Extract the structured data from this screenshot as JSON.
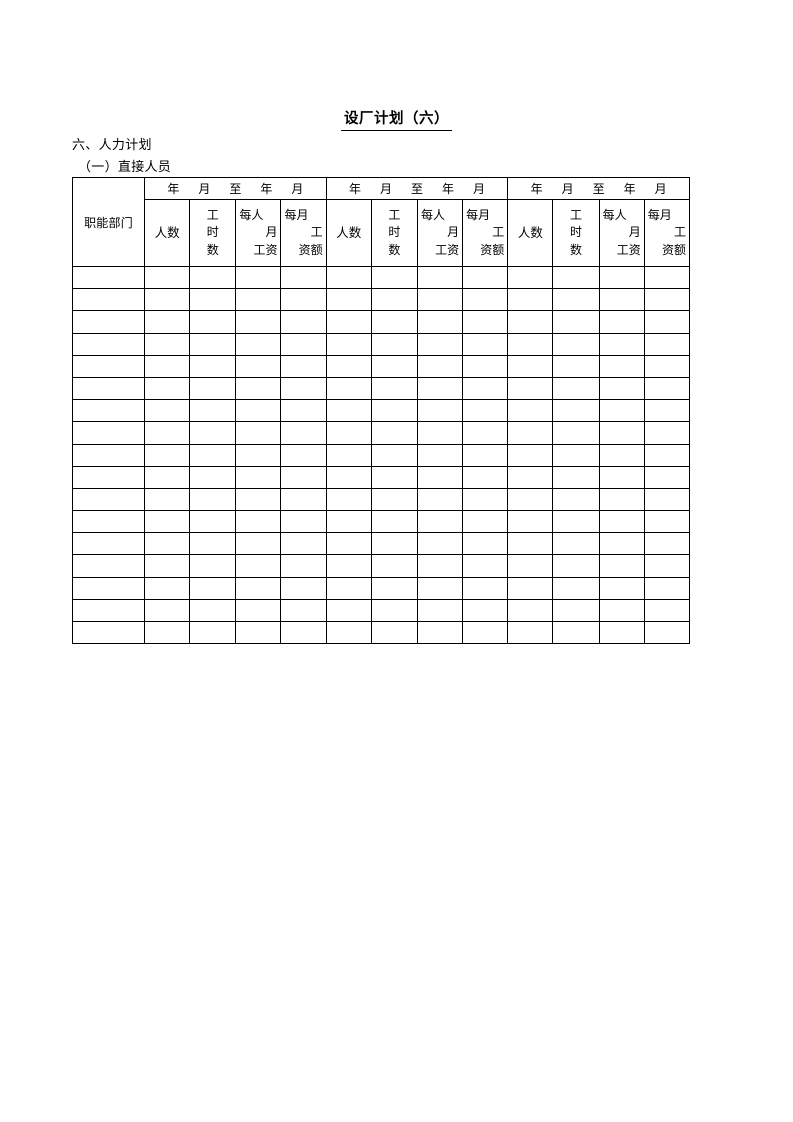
{
  "document": {
    "title": "设厂计划（六）",
    "section_heading": "六、人力计划",
    "subsection_heading": "（一）直接人员"
  },
  "table": {
    "row_label_header": "职能部门",
    "period_label": "年　月　至　年　月",
    "periods": [
      {
        "index": 1,
        "label": "年　月　至　年　月"
      },
      {
        "index": 2,
        "label": "年　月　至　年　月"
      },
      {
        "index": 3,
        "label": "年　月　至　年　月"
      }
    ],
    "column_headers": [
      {
        "key": "headcount",
        "label": "人数",
        "lines": [
          "人数"
        ]
      },
      {
        "key": "work_hours",
        "label": "工时数",
        "lines": [
          "工",
          "时",
          "数"
        ]
      },
      {
        "key": "wage_per_person_month",
        "label": "每人月工资",
        "lines": [
          "每人",
          "月",
          "工资"
        ]
      },
      {
        "key": "wage_total_month",
        "label": "每月工资额",
        "lines": [
          "每月",
          "工",
          "资额"
        ]
      }
    ],
    "data_rows": [
      {
        "dept": "",
        "cells": [
          "",
          "",
          "",
          "",
          "",
          "",
          "",
          "",
          "",
          "",
          "",
          ""
        ]
      },
      {
        "dept": "",
        "cells": [
          "",
          "",
          "",
          "",
          "",
          "",
          "",
          "",
          "",
          "",
          "",
          ""
        ]
      },
      {
        "dept": "",
        "cells": [
          "",
          "",
          "",
          "",
          "",
          "",
          "",
          "",
          "",
          "",
          "",
          ""
        ]
      },
      {
        "dept": "",
        "cells": [
          "",
          "",
          "",
          "",
          "",
          "",
          "",
          "",
          "",
          "",
          "",
          ""
        ]
      },
      {
        "dept": "",
        "cells": [
          "",
          "",
          "",
          "",
          "",
          "",
          "",
          "",
          "",
          "",
          "",
          ""
        ]
      },
      {
        "dept": "",
        "cells": [
          "",
          "",
          "",
          "",
          "",
          "",
          "",
          "",
          "",
          "",
          "",
          ""
        ]
      },
      {
        "dept": "",
        "cells": [
          "",
          "",
          "",
          "",
          "",
          "",
          "",
          "",
          "",
          "",
          "",
          ""
        ]
      },
      {
        "dept": "",
        "cells": [
          "",
          "",
          "",
          "",
          "",
          "",
          "",
          "",
          "",
          "",
          "",
          ""
        ]
      },
      {
        "dept": "",
        "cells": [
          "",
          "",
          "",
          "",
          "",
          "",
          "",
          "",
          "",
          "",
          "",
          ""
        ]
      },
      {
        "dept": "",
        "cells": [
          "",
          "",
          "",
          "",
          "",
          "",
          "",
          "",
          "",
          "",
          "",
          ""
        ]
      },
      {
        "dept": "",
        "cells": [
          "",
          "",
          "",
          "",
          "",
          "",
          "",
          "",
          "",
          "",
          "",
          ""
        ]
      },
      {
        "dept": "",
        "cells": [
          "",
          "",
          "",
          "",
          "",
          "",
          "",
          "",
          "",
          "",
          "",
          ""
        ]
      },
      {
        "dept": "",
        "cells": [
          "",
          "",
          "",
          "",
          "",
          "",
          "",
          "",
          "",
          "",
          "",
          ""
        ]
      },
      {
        "dept": "",
        "cells": [
          "",
          "",
          "",
          "",
          "",
          "",
          "",
          "",
          "",
          "",
          "",
          ""
        ]
      },
      {
        "dept": "",
        "cells": [
          "",
          "",
          "",
          "",
          "",
          "",
          "",
          "",
          "",
          "",
          "",
          ""
        ]
      },
      {
        "dept": "",
        "cells": [
          "",
          "",
          "",
          "",
          "",
          "",
          "",
          "",
          "",
          "",
          "",
          ""
        ]
      },
      {
        "dept": "",
        "cells": [
          "",
          "",
          "",
          "",
          "",
          "",
          "",
          "",
          "",
          "",
          "",
          ""
        ]
      }
    ],
    "row_count": 17,
    "column_count": 13
  },
  "style": {
    "border_color": "#000000",
    "text_color": "#000000",
    "background": "#ffffff"
  }
}
